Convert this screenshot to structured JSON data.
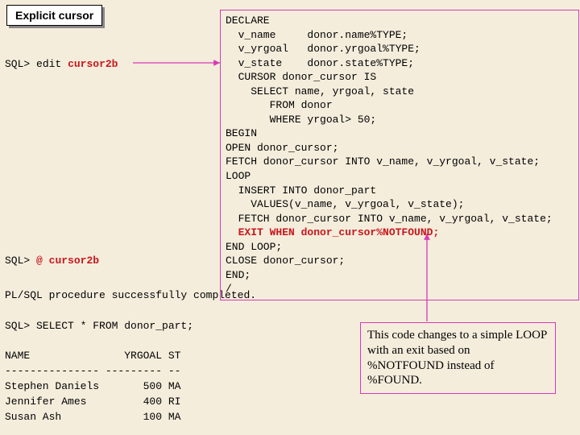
{
  "title": "Explicit cursor",
  "sql_prompt": "SQL>",
  "edit_cmd": "edit",
  "script_name": "cursor2b",
  "at_cmd": "@",
  "code": {
    "l1": "DECLARE",
    "l2": "  v_name     donor.name%TYPE;",
    "l3": "  v_yrgoal   donor.yrgoal%TYPE;",
    "l4": "  v_state    donor.state%TYPE;",
    "l5": "  CURSOR donor_cursor IS",
    "l6": "    SELECT name, yrgoal, state",
    "l7": "       FROM donor",
    "l8": "       WHERE yrgoal> 50;",
    "l9": "BEGIN",
    "l10": "OPEN donor_cursor;",
    "l11": "FETCH donor_cursor INTO v_name, v_yrgoal, v_state;",
    "l12": "LOOP",
    "l13": "  INSERT INTO donor_part",
    "l14": "    VALUES(v_name, v_yrgoal, v_state);",
    "l15": "  FETCH donor_cursor INTO v_name, v_yrgoal, v_state;",
    "l16": "  EXIT WHEN donor_cursor%NOTFOUND;",
    "l17": "END LOOP;",
    "l18": "CLOSE donor_cursor;",
    "l19": "END;",
    "l20": "/"
  },
  "bottom": {
    "l1": "PL/SQL procedure successfully completed.",
    "l2": "",
    "l3": "SQL> SELECT * FROM donor_part;",
    "l4": "",
    "l5": "NAME               YRGOAL ST",
    "l6": "--------------- --------- --",
    "l7": "Stephen Daniels       500 MA",
    "l8": "Jennifer Ames         400 RI",
    "l9": "Susan Ash             100 MA"
  },
  "annotation": "This code changes to a simple LOOP with an exit based on %NOTFOUND instead of %FOUND."
}
